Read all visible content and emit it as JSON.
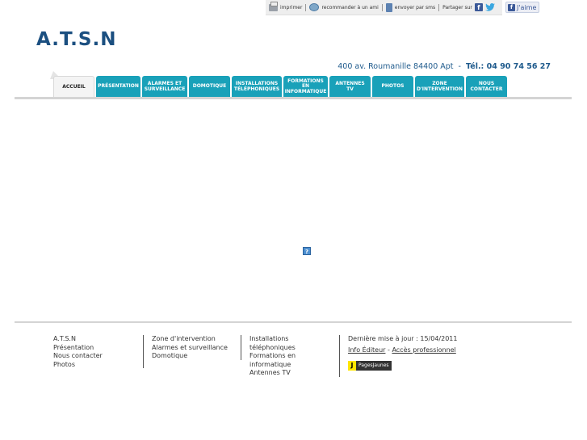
{
  "toolbar": {
    "print": "imprimer",
    "recommend": "recommander à un ami",
    "sms": "envoyer par sms",
    "share": "Partager sur",
    "fb_letter": "f",
    "like": "J'aime"
  },
  "site": {
    "logo": "A.T.S.N",
    "address": "400 av. Roumanille 84400 Apt",
    "tel_label": "Tél.: 04 90 74 56 27"
  },
  "nav": [
    {
      "label": "Accueil"
    },
    {
      "label": "Présentation"
    },
    {
      "label": "Alarmes et surveillance"
    },
    {
      "label": "Domotique"
    },
    {
      "label": "Installations téléphoniques"
    },
    {
      "label": "Formations en informatique"
    },
    {
      "label": "Antennes TV"
    },
    {
      "label": "Photos"
    },
    {
      "label": "Zone d'intervention"
    },
    {
      "label": "Nous contacter"
    }
  ],
  "content": {
    "missing_plugin": "?"
  },
  "footer": {
    "col1": [
      "A.T.S.N",
      "Présentation",
      "Nous contacter",
      "Photos"
    ],
    "col2": [
      "Zone d'intervention",
      "Alarmes et surveillance",
      "Domotique"
    ],
    "col3": [
      "Installations",
      "téléphoniques",
      "Formations en",
      "informatique",
      "Antennes TV"
    ],
    "last_update": "Dernière mise à jour : 15/04/2011",
    "info_editor": "Info Éditeur",
    "dash": " - ",
    "pro_access": "Accès professionnel",
    "pj_icon": "J",
    "pj_text": "PagesJaunes"
  },
  "colors": {
    "accent": "#19a1b9",
    "brand": "#1b4f80"
  }
}
